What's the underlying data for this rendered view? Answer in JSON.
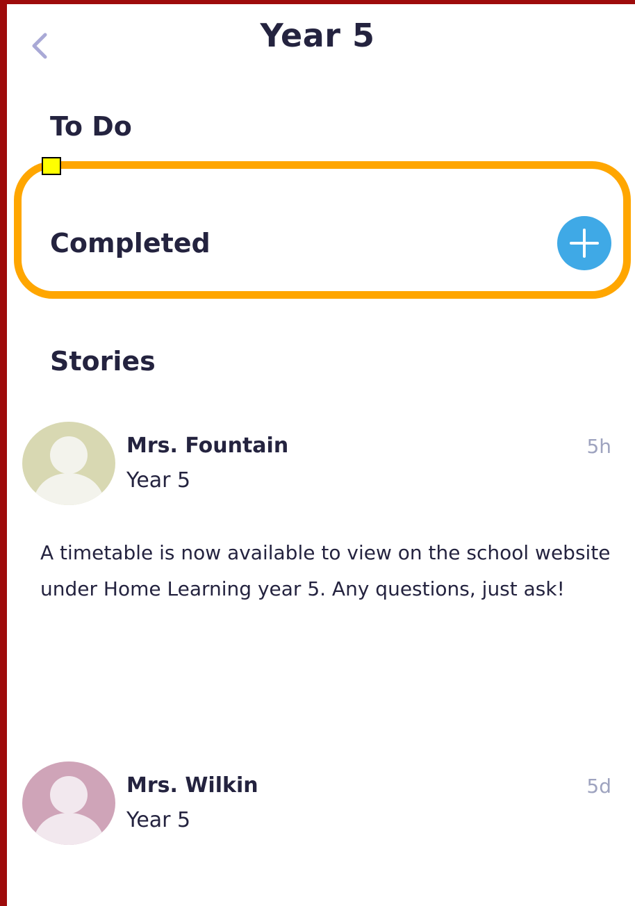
{
  "header": {
    "title": "Year 5",
    "back_icon": "chevron-left-icon"
  },
  "sections": {
    "todo_label": "To Do",
    "completed_label": "Completed",
    "stories_label": "Stories"
  },
  "colors": {
    "highlight": "#ffa600",
    "add_button": "#3fa9e6",
    "marker": "#ffff00",
    "frame": "#9e0b0b"
  },
  "stories": [
    {
      "author": "Mrs. Fountain",
      "class_name": "Year 5",
      "time": "5h",
      "body": "A timetable is now available to view on the school website under Home Learning year 5. Any questions, just ask!",
      "avatar_color": "#d8d8b2"
    },
    {
      "author": "Mrs. Wilkin",
      "class_name": "Year 5",
      "time": "5d",
      "body": "",
      "avatar_color": "#cfa4b8"
    }
  ]
}
